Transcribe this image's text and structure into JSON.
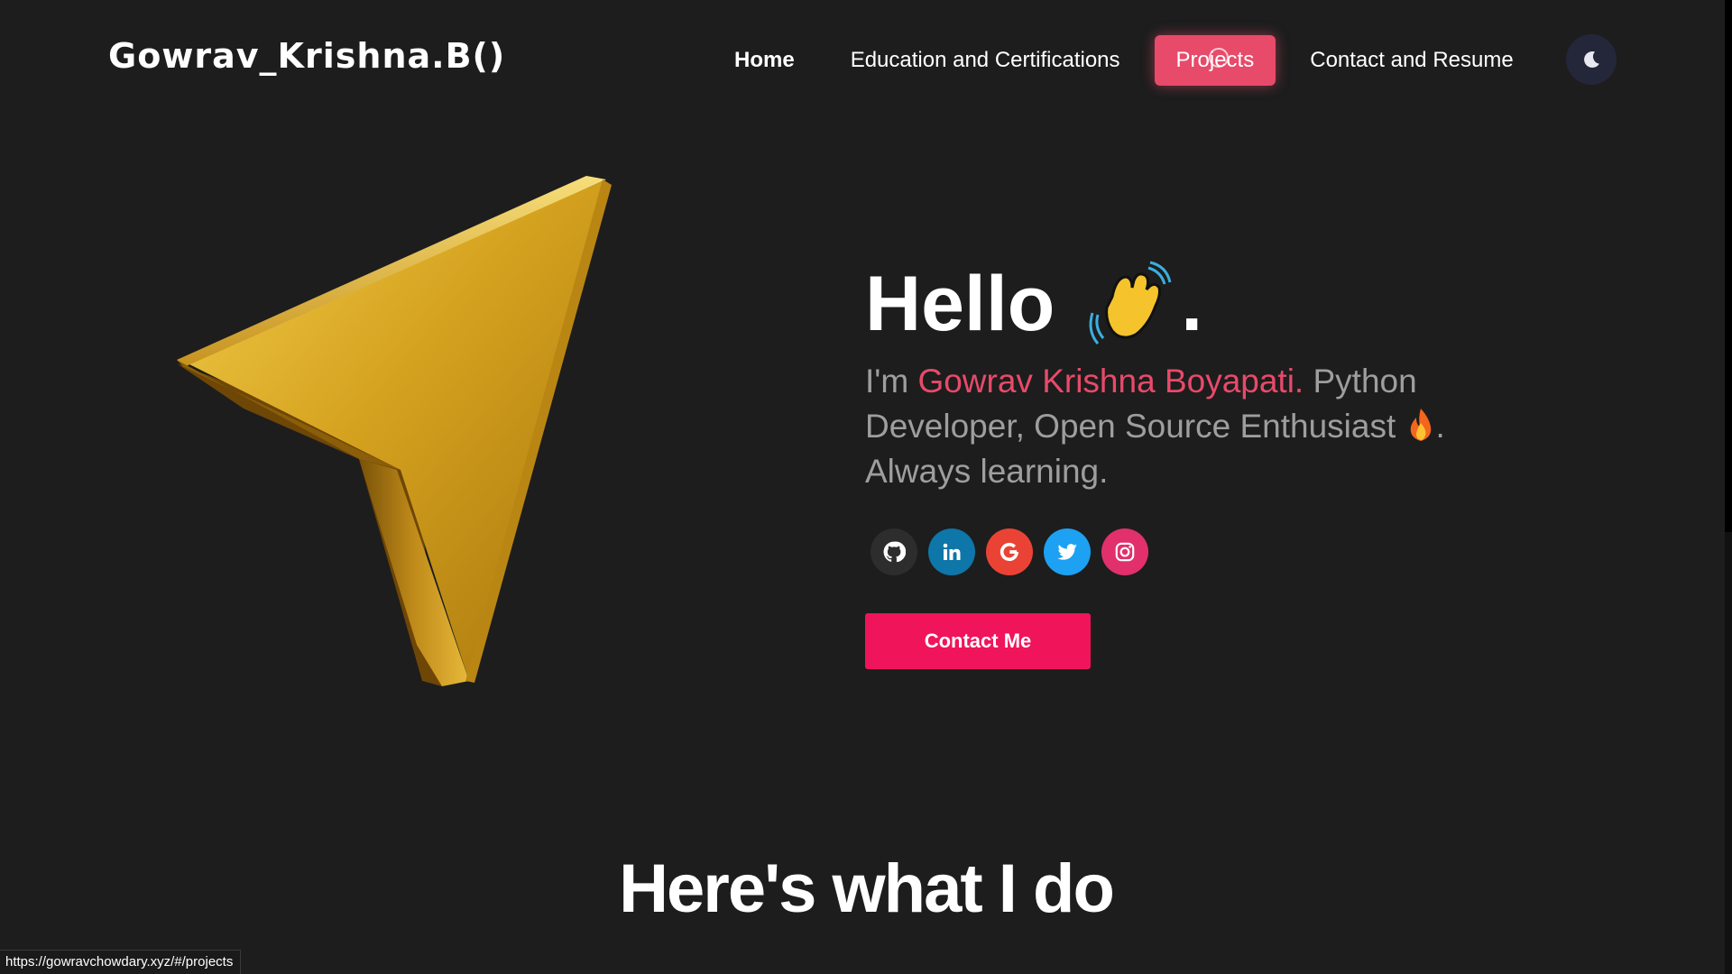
{
  "header": {
    "logo": "Gowrav_Krishna.B()",
    "nav": [
      {
        "label": "Home"
      },
      {
        "label": "Education and Certifications"
      },
      {
        "label": "Projects"
      },
      {
        "label": "Contact and Resume"
      }
    ],
    "active_nav": "Projects",
    "theme_toggle_icon": "moon-icon"
  },
  "hero": {
    "greeting": "Hello",
    "greeting_suffix": ".",
    "greeting_icon": "waving-hand-icon",
    "intro_prefix": "I'm ",
    "name": "Gowrav Krishna Boyapati.",
    "intro_rest": " Python Developer, Open Source Enthusiast ",
    "intro_icon": "fire-icon",
    "intro_after_icon": ".",
    "intro_last": "Always learning.",
    "socials": [
      {
        "name": "github-icon",
        "color": "#2d2d2d"
      },
      {
        "name": "linkedin-icon",
        "color": "#0e76a8"
      },
      {
        "name": "google-icon",
        "color": "#ea4335"
      },
      {
        "name": "twitter-icon",
        "color": "#1da1f2"
      },
      {
        "name": "instagram-icon",
        "color": "#e1306c"
      }
    ],
    "contact_button": "Contact Me",
    "art_icon": "gold-navigation-arrow-icon"
  },
  "section": {
    "title": "Here's what I do"
  },
  "status_bar": {
    "url": "https://gowravchowdary.xyz/#/projects"
  },
  "colors": {
    "background": "#1d1d1d",
    "accent": "#e84a6a",
    "button": "#f0145a",
    "muted_text": "#9e9e9e"
  }
}
